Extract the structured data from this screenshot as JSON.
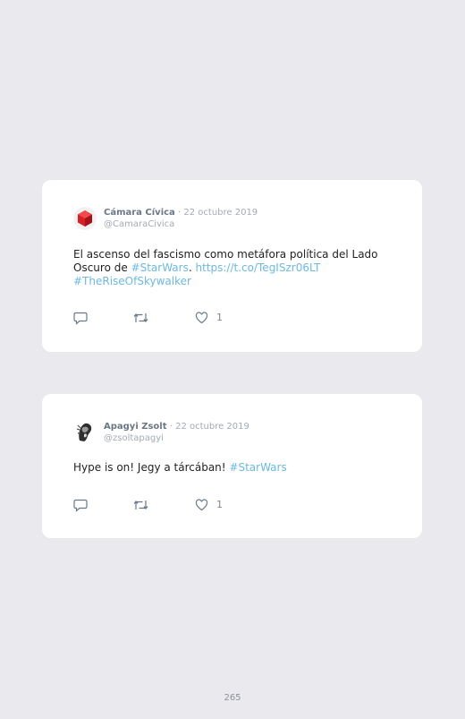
{
  "tweets": [
    {
      "author": "Cámara Cívica",
      "separator": "·",
      "date": "22 octubre 2019",
      "handle": "@CamaraCivica",
      "text_1": "El ascenso del fascismo como metáfora política del Lado",
      "text_2": "Oscuro de ",
      "hashtag_1": "#StarWars",
      "text_3": ". ",
      "url": "https://t.co/TegISzr06LT",
      "hashtag_2": "#TheRiseOfSkywalker",
      "likes": "1"
    },
    {
      "author": "Apagyi Zsolt",
      "separator": "·",
      "date": "22 octubre 2019",
      "handle": "@zsoltapagyi",
      "text_1": "Hype is on! Jegy a tárcában! ",
      "hashtag_1": "#StarWars",
      "likes": "1"
    }
  ],
  "footer": {
    "page_number": "265"
  },
  "colors": {
    "link": "#6cb9e0",
    "background": "#e9e9ee",
    "card": "#ffffff"
  }
}
